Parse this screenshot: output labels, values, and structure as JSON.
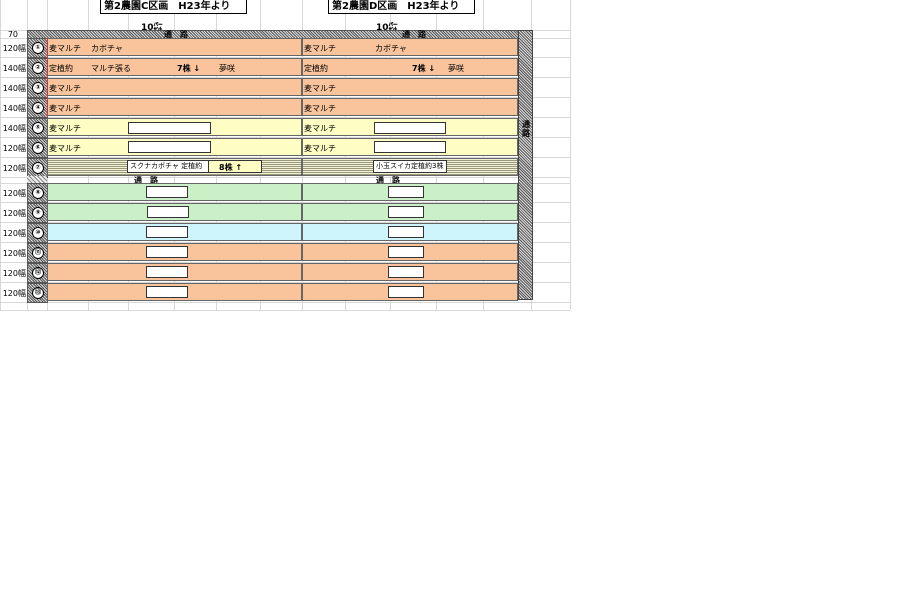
{
  "titles": {
    "left": "第2農園C区画　H23年より",
    "right": "第2農園D区画　H23年より",
    "left_pct": "10㌫",
    "right_pct": "10㌫"
  },
  "path_label": "通　路",
  "side_path_label": "通路",
  "top_width": "70",
  "rows": [
    {
      "width": "120幅",
      "num": "①",
      "left": "麦マルチ",
      "left2": "カボチャ",
      "right": "麦マルチ",
      "right2": "カボチャ"
    },
    {
      "width": "140幅",
      "num": "②",
      "left": "定植約",
      "left2": "マルチ張る",
      "left_count": "7株 ↓",
      "left_flower": "夢咲",
      "right": "定植約",
      "right_count": "7株 ↓",
      "right_flower": "夢咲"
    },
    {
      "width": "140幅",
      "num": "③",
      "left": "麦マルチ",
      "right": "麦マルチ"
    },
    {
      "width": "140幅",
      "num": "④",
      "left": "麦マルチ",
      "right": "麦マルチ"
    },
    {
      "width": "140幅",
      "num": "⑤",
      "left": "麦マルチ",
      "right": "麦マルチ"
    },
    {
      "width": "120幅",
      "num": "⑥",
      "left": "麦マルチ",
      "right": "麦マルチ"
    },
    {
      "width": "120幅",
      "num": "⑦",
      "left_box": "スクナカボチャ 定植約",
      "left_count": "8株 ↑",
      "right_box": "小玉スイカ定植約3株"
    },
    {
      "width": "120幅",
      "num": "⑧"
    },
    {
      "width": "120幅",
      "num": "⑨"
    },
    {
      "width": "120幅",
      "num": "⑩"
    },
    {
      "width": "120幅",
      "num": "⑪"
    },
    {
      "width": "120幅",
      "num": "⑫"
    },
    {
      "width": "120幅",
      "num": "⑬"
    }
  ]
}
